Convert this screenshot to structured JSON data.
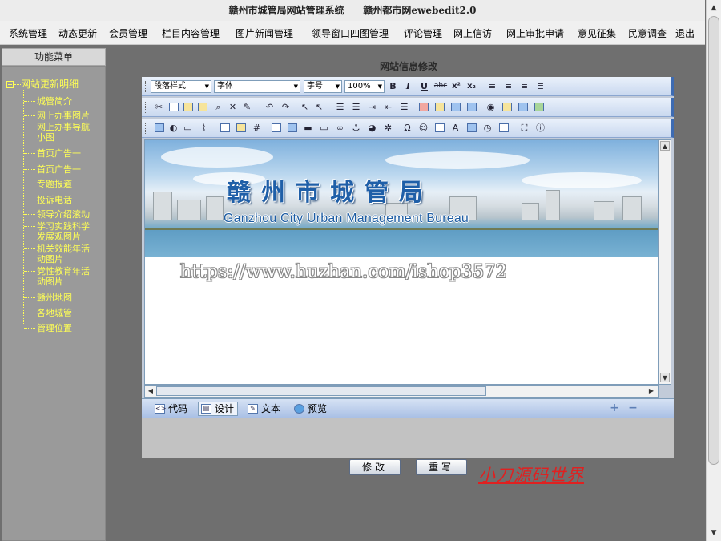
{
  "header": {
    "title": "赣州市城管局网站管理系统",
    "subtitle": "赣州都市网ewebedit2.0"
  },
  "menu": [
    "系统管理",
    "动态更新",
    "会员管理",
    "栏目内容管理",
    "图片新闻管理",
    "领导窗口四图管理",
    "评论管理",
    "网上信访",
    "网上审批申请",
    "意见征集",
    "民意调查",
    "退出"
  ],
  "sidebar": {
    "title": "功能菜单",
    "root": "网站更新明细",
    "items": [
      "城管简介",
      "网上办事图片",
      "网上办事导航小图",
      "首页广告一",
      "首页广告一",
      "专题报道",
      "投诉电话",
      "领导介绍滚动",
      "学习实践科学发展观图片",
      "机关效能年活动图片",
      "党性教育年活动图片",
      "赣州地图",
      "各地城管",
      "管理位置"
    ]
  },
  "content": {
    "title": "网站信息修改"
  },
  "editor": {
    "dropdowns": {
      "paragraph_style": "段落样式",
      "font": "字体",
      "font_size": "字号",
      "zoom": "100%"
    },
    "format_buttons": [
      "B",
      "I",
      "U",
      "abc",
      "x²",
      "x₂"
    ],
    "banner": {
      "title_cn": "赣州市城管局",
      "title_en": "Ganzhou City Urban Management Bureau"
    },
    "watermark": "https://www.huzhan.com/ishop3572",
    "modes": [
      {
        "label": "代码",
        "icon": "code-icon"
      },
      {
        "label": "设计",
        "icon": "design-icon"
      },
      {
        "label": "文本",
        "icon": "text-icon"
      },
      {
        "label": "预览",
        "icon": "preview-icon"
      }
    ],
    "active_mode": "设计"
  },
  "buttons": {
    "submit": "修改",
    "reset": "重写"
  },
  "brand": "小刀源码世界"
}
